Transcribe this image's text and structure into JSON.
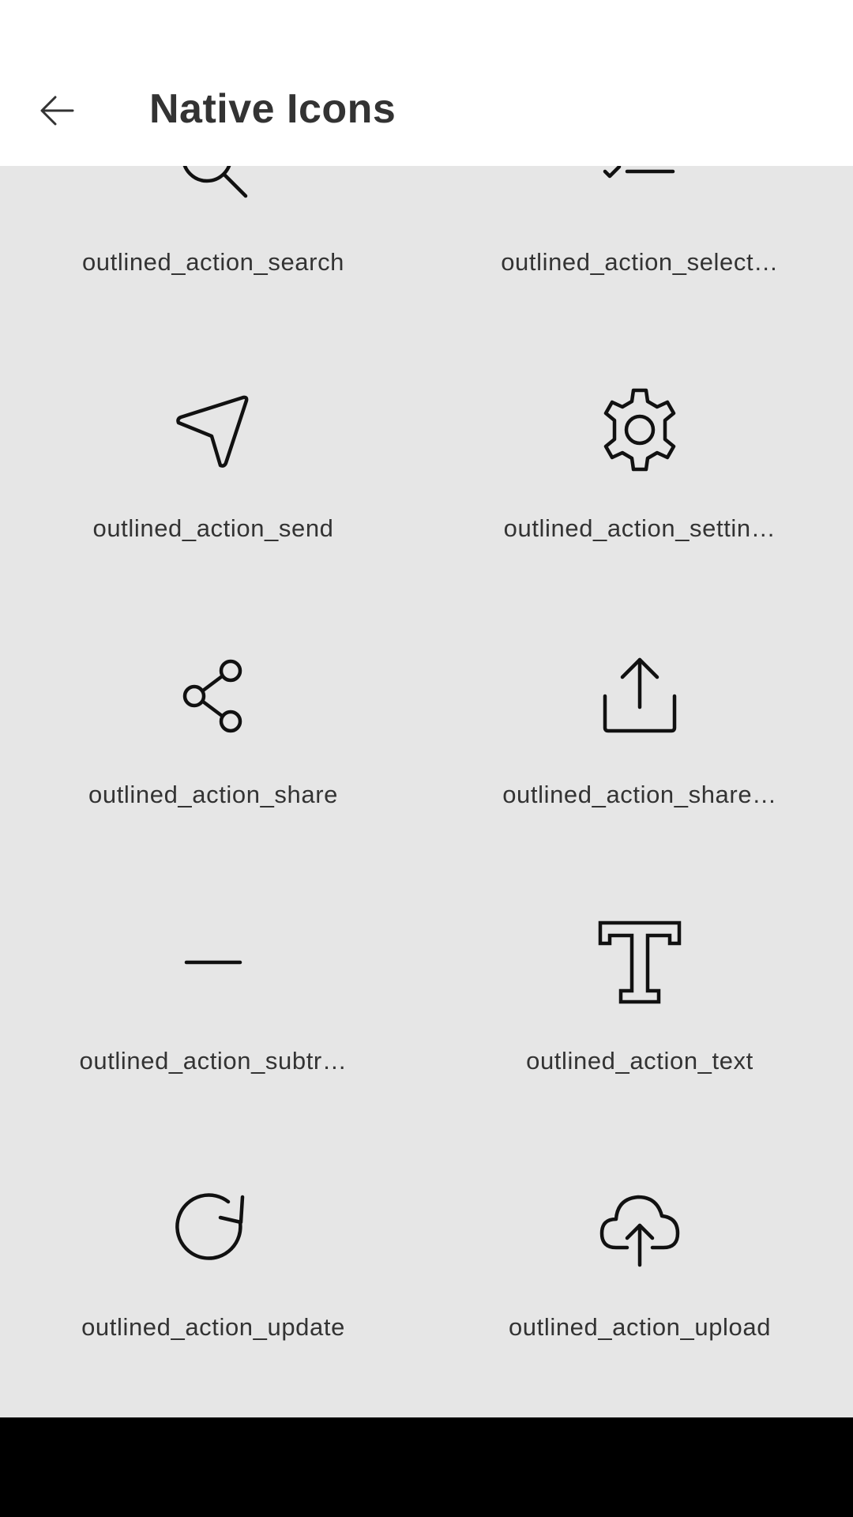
{
  "header": {
    "title": "Native Icons",
    "back_icon": "arrow-left-icon"
  },
  "icons": [
    {
      "label": "outlined_action_search",
      "icon": "search-icon"
    },
    {
      "label": "outlined_action_select…",
      "icon": "select-check-icon"
    },
    {
      "label": "outlined_action_send",
      "icon": "send-icon"
    },
    {
      "label": "outlined_action_settin…",
      "icon": "gear-icon"
    },
    {
      "label": "outlined_action_share",
      "icon": "share-icon"
    },
    {
      "label": "outlined_action_share…",
      "icon": "share-upload-icon"
    },
    {
      "label": "outlined_action_subtr…",
      "icon": "minus-icon"
    },
    {
      "label": "outlined_action_text",
      "icon": "text-t-icon"
    },
    {
      "label": "outlined_action_update",
      "icon": "refresh-icon"
    },
    {
      "label": "outlined_action_upload",
      "icon": "cloud-upload-icon"
    }
  ],
  "colors": {
    "background": "#e6e6e6",
    "app_bar": "#ffffff",
    "text": "#333333",
    "icon_stroke": "#111111",
    "nav_bar": "#000000"
  }
}
